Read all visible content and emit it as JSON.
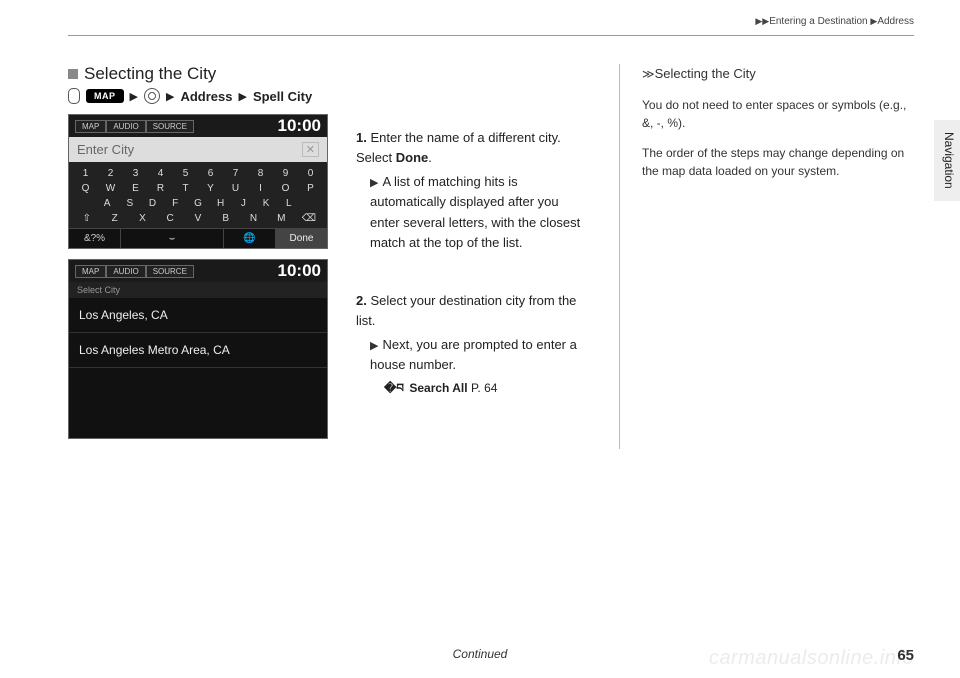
{
  "header": {
    "section": "Entering a Destination",
    "subsection": "Address"
  },
  "section": {
    "title": "Selecting the City"
  },
  "path": {
    "map": "MAP",
    "item1": "Address",
    "item2": "Spell City"
  },
  "shot1": {
    "tabs": [
      "MAP",
      "AUDIO",
      "SOURCE"
    ],
    "time": "10:00",
    "placeholder": "Enter City",
    "bottom": [
      "&?%",
      "",
      "",
      "Done"
    ]
  },
  "shot2": {
    "tabs": [
      "MAP",
      "AUDIO",
      "SOURCE"
    ],
    "time": "10:00",
    "listTitle": "Select City",
    "items": [
      "Los Angeles, CA",
      "Los Angeles Metro Area, CA"
    ]
  },
  "steps": [
    {
      "num": "1.",
      "text": "Enter the name of a different city.",
      "text2": "Select",
      "bold": "Done",
      "sub": "A list of matching hits is automatically displayed after you enter several letters, with the closest match at the top of the list."
    },
    {
      "num": "2.",
      "text": "Select your destination city from the list.",
      "sub": "Next, you are prompted to enter a house number.",
      "ref": "Search All",
      "refPage": "P. 64"
    }
  ],
  "notes": {
    "title": "Selecting the City",
    "p1": "You do not need to enter spaces or symbols (e.g., &, -, %).",
    "p2": "The order of the steps may change depending on the map data loaded on your system."
  },
  "sideTab": "Navigation",
  "footer": {
    "continued": "Continued",
    "page": "65",
    "watermark": "carmanualsonline.info"
  }
}
